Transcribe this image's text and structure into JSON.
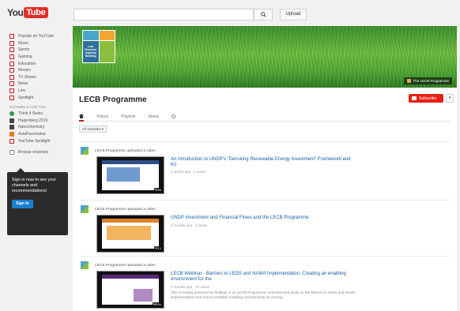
{
  "header": {
    "logo_you": "You",
    "logo_tube": "Tube",
    "search_placeholder": "",
    "upload_label": "Upload"
  },
  "sidebar": {
    "items": [
      {
        "label": "Popular on YouTube",
        "icon": "popular-icon"
      },
      {
        "label": "Music",
        "icon": "music-icon"
      },
      {
        "label": "Sports",
        "icon": "sports-icon"
      },
      {
        "label": "Gaming",
        "icon": "gaming-icon"
      },
      {
        "label": "Education",
        "icon": "education-icon"
      },
      {
        "label": "Movies",
        "icon": "movies-icon"
      },
      {
        "label": "TV Shows",
        "icon": "tv-shows-icon"
      },
      {
        "label": "News",
        "icon": "news-icon"
      },
      {
        "label": "Live",
        "icon": "live-icon"
      },
      {
        "label": "Spotlight",
        "icon": "spotlight-icon"
      }
    ],
    "heading": "CHANNELS FOR YOU",
    "channels": [
      {
        "label": "Think 4 Swiss"
      },
      {
        "label": "Hagenberg 2010"
      },
      {
        "label": "Nanochemistry"
      },
      {
        "label": "AsiaPacemaker"
      },
      {
        "label": "YouTube Spotlight"
      }
    ],
    "browse_label": "Browse channels",
    "signin_text": "Sign in now to see your channels and recommendations!",
    "signin_button": "Sign In"
  },
  "channel": {
    "title": "LECB Programme",
    "banner_link": "The LECB Programme",
    "tile_text": "Low Emission Capacity Building",
    "subscribe_label": "Subscribe",
    "settings_label": "▾",
    "tabs": [
      "Videos",
      "Playlists",
      "About"
    ],
    "filter_label": "All activities ▾"
  },
  "feed": [
    {
      "header": "LECB Programme uploaded a video",
      "title": "An Introduction to UNDP's \"Derisking Renewable Energy Investment\" Framework and Kit",
      "meta": "4 weeks ago · 1 views",
      "duration": "4:45",
      "desc": ""
    },
    {
      "header": "LECB Programme uploaded a video",
      "title": "UNDP Investment and Financial Flows and the LECB Programme",
      "meta": "2 months ago · 3 views",
      "duration": "3:12",
      "desc": ""
    },
    {
      "header": "LECB Programme uploaded a video",
      "title": "LECB Webinar - Barriers to LEDS and NAMA Implementation: Creating an enabling environment for the",
      "meta": "3 months ago · 13 views",
      "duration": "54:40",
      "desc": "This recording presents the findings of an LECB Programme commissioned study on the barriers to LEDS and NAMA implementation and how to establish enabling environments for moving"
    }
  ],
  "colors": {
    "brand_red": "#e62117",
    "link_blue": "#1b5ea5",
    "signin_blue": "#1b7fcc"
  }
}
